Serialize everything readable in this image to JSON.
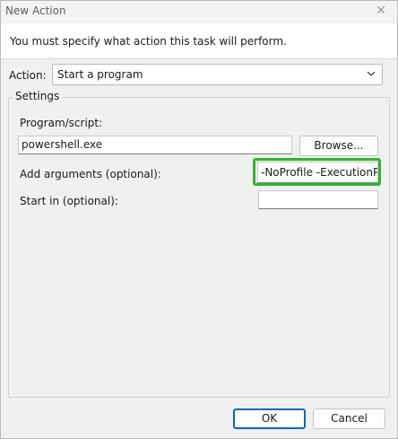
{
  "window": {
    "title": "New Action",
    "close_icon": "close-icon"
  },
  "header": {
    "text": "You must specify what action this task will perform."
  },
  "action": {
    "label": "Action:",
    "selected": "Start a program"
  },
  "settings": {
    "legend": "Settings",
    "program_label": "Program/script:",
    "program_value": "powershell.exe",
    "browse_label": "Browse...",
    "args_label": "Add arguments (optional):",
    "args_value": "-NoProfile -ExecutionPo",
    "startin_label": "Start in (optional):",
    "startin_value": ""
  },
  "footer": {
    "ok_label": "OK",
    "cancel_label": "Cancel"
  },
  "colors": {
    "highlight": "#2fb62f",
    "accent": "#0067c0"
  }
}
